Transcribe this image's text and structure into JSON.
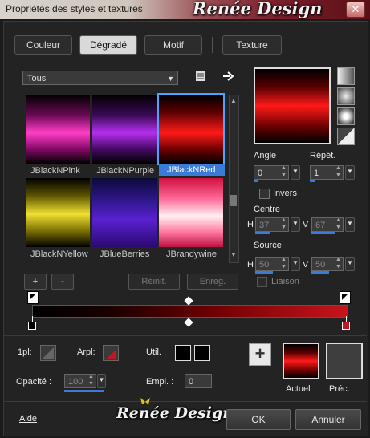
{
  "window": {
    "title": "Propriétés des styles et textures",
    "close_glyph": "✕"
  },
  "watermark": {
    "text": "Renée Design"
  },
  "tabs": [
    {
      "label": "Couleur",
      "selected": false
    },
    {
      "label": "Dégradé",
      "selected": true
    },
    {
      "label": "Motif",
      "selected": false
    },
    {
      "label": "Texture",
      "selected": false
    }
  ],
  "category": {
    "value": "Tous"
  },
  "gradients": [
    {
      "label": "JBlackNPink"
    },
    {
      "label": "JBlackNPurple"
    },
    {
      "label": "JBlackNRed",
      "selected": true
    },
    {
      "label": "JBlackNYellow"
    },
    {
      "label": "JBlueBerries"
    },
    {
      "label": "JBrandywine"
    }
  ],
  "buttons": {
    "add": "+",
    "remove": "-",
    "reset": "Réinit.",
    "save": "Enreg."
  },
  "angle": {
    "label": "Angle",
    "value": "0"
  },
  "repeat": {
    "label": "Répét.",
    "value": "1"
  },
  "invert": {
    "label": "Invers",
    "checked": false
  },
  "center": {
    "label": "Centre",
    "h_label": "H",
    "h_value": "37",
    "v_label": "V",
    "v_value": "67"
  },
  "source": {
    "label": "Source",
    "h_label": "H",
    "h_value": "50",
    "v_label": "V",
    "v_value": "50"
  },
  "link": {
    "label": "Liaison",
    "checked": false
  },
  "fg_label": "1pl:",
  "bg_label": "Arpl:",
  "use_label": "Util. :",
  "opacity": {
    "label": "Opacité :",
    "value": "100"
  },
  "location": {
    "label": "Empl. :",
    "value": "0"
  },
  "current": {
    "label": "Actuel"
  },
  "previous": {
    "label": "Préc."
  },
  "footer": {
    "help": "Aide",
    "ok": "OK",
    "cancel": "Annuler"
  },
  "colors": {
    "accent": "#3b7bd8",
    "stop_end": "#c8141c"
  }
}
